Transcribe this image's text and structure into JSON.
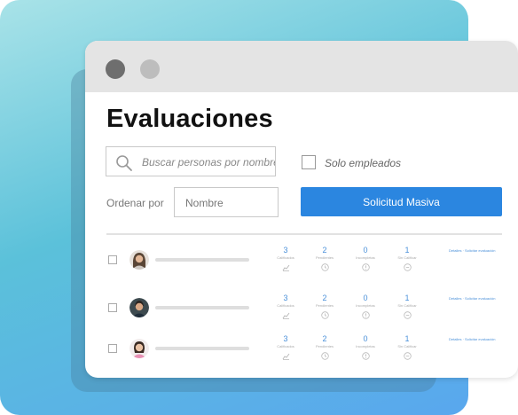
{
  "header": {
    "title": "Evaluaciones"
  },
  "search": {
    "placeholder": "Buscar personas por nombre"
  },
  "filter": {
    "only_employees_label": "Solo empleados",
    "only_employees_checked": false
  },
  "sort": {
    "label": "Ordenar por",
    "value": "Nombre"
  },
  "actions": {
    "bulk_request_label": "Solicitud Masiva"
  },
  "colors": {
    "accent": "#2b86e0",
    "stat_number": "#4a90d9"
  },
  "stat_labels": [
    "Calificados",
    "Pendientes",
    "Incompletas",
    "Sin Calificar"
  ],
  "rows": [
    {
      "checked": false,
      "stats": [
        "3",
        "2",
        "0",
        "1"
      ],
      "links": "Detalles · Solicitar evaluación"
    },
    {
      "checked": false,
      "stats": [
        "3",
        "2",
        "0",
        "1"
      ],
      "links": "Detalles · Solicitar evaluación"
    },
    {
      "checked": false,
      "stats": [
        "3",
        "2",
        "0",
        "1"
      ],
      "links": "Detalles · Solicitar evaluación"
    }
  ]
}
